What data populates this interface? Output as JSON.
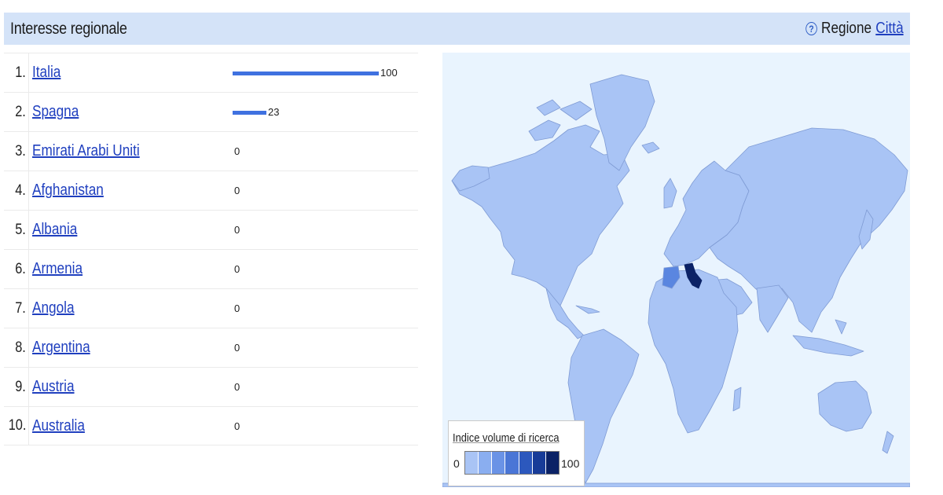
{
  "header": {
    "title": "Interesse regionale",
    "help_icon": "question-circle-icon",
    "region_label": "Regione",
    "city_link": "Città"
  },
  "ranking": [
    {
      "rank": "1.",
      "country": "Italia",
      "value": 100
    },
    {
      "rank": "2.",
      "country": "Spagna",
      "value": 23
    },
    {
      "rank": "3.",
      "country": "Emirati Arabi Uniti",
      "value": 0
    },
    {
      "rank": "4.",
      "country": "Afghanistan",
      "value": 0
    },
    {
      "rank": "5.",
      "country": "Albania",
      "value": 0
    },
    {
      "rank": "6.",
      "country": "Armenia",
      "value": 0
    },
    {
      "rank": "7.",
      "country": "Angola",
      "value": 0
    },
    {
      "rank": "8.",
      "country": "Argentina",
      "value": 0
    },
    {
      "rank": "9.",
      "country": "Austria",
      "value": 0
    },
    {
      "rank": "10.",
      "country": "Australia",
      "value": 0
    }
  ],
  "legend": {
    "title": "Indice volume di ricerca",
    "min": "0",
    "max": "100",
    "scale_colors": [
      "#a9c4f5",
      "#8aaef0",
      "#6a93e6",
      "#4a76d6",
      "#2c58bd",
      "#183c98",
      "#0b2266"
    ]
  },
  "colors": {
    "header_bg": "#d4e3f8",
    "bar": "#3f71e0",
    "link": "#1f3fbf",
    "map_ocean": "#e9f4fe",
    "map_land": "#a9c4f5",
    "map_border": "#7f9bd4",
    "map_high": "#0b2266",
    "map_mid": "#5a86e0"
  }
}
